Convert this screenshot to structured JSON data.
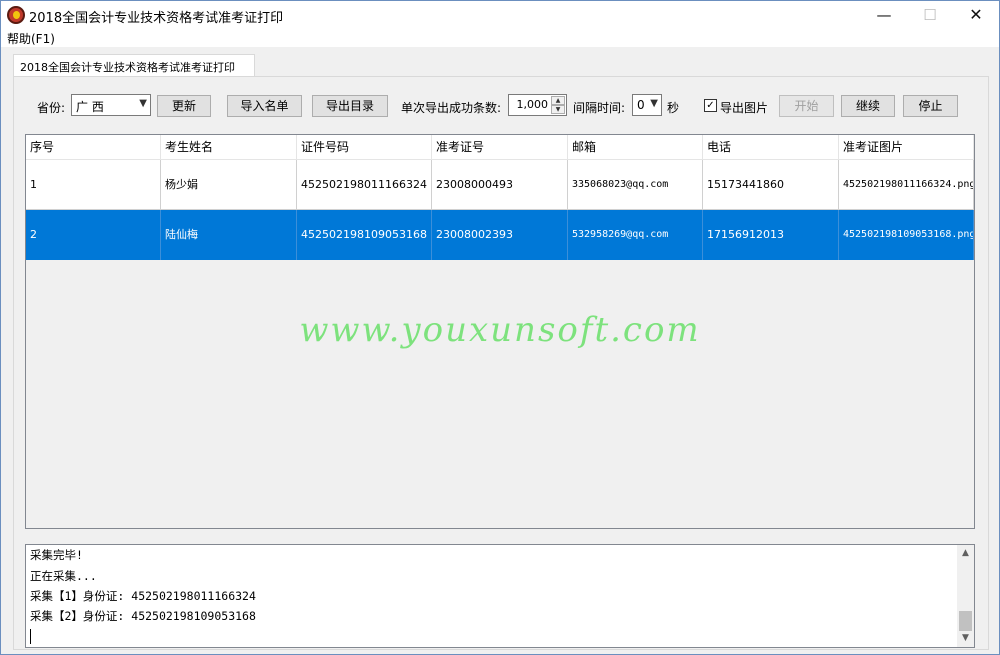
{
  "window": {
    "title": "2018全国会计专业技术资格考试准考证打印",
    "minimize": "—",
    "maximize": "☐",
    "close": "✕"
  },
  "menu": {
    "help": "帮助(F1)"
  },
  "tab": {
    "label": "2018全国会计专业技术资格考试准考证打印"
  },
  "toolbar": {
    "province_label": "省份:",
    "province_value": "广 西",
    "refresh": "更新",
    "import": "导入名单",
    "export_dir": "导出目录",
    "batch_label": "单次导出成功条数:",
    "batch_value": "1,000",
    "interval_label": "间隔时间:",
    "interval_value": "0",
    "seconds_label": "秒",
    "export_image_label": "导出图片",
    "export_image_checked": true,
    "check_mark": "✓",
    "start": "开始",
    "continue": "继续",
    "stop": "停止"
  },
  "table": {
    "headers": [
      "序号",
      "考生姓名",
      "证件号码",
      "准考证号",
      "邮箱",
      "电话",
      "准考证图片"
    ],
    "rows": [
      [
        "1",
        "杨少娟",
        "452502198011166324",
        "23008000493",
        "335068023@qq.com",
        "15173441860",
        "452502198011166324.png"
      ],
      [
        "2",
        "陆仙梅",
        "452502198109053168",
        "23008002393",
        "532958269@qq.com",
        "17156912013",
        "452502198109053168.png"
      ]
    ],
    "selected_row": 1
  },
  "watermark": "www.youxunsoft.com",
  "log": {
    "lines": [
      "采集完毕!",
      "正在采集...",
      "采集【1】身份证: 452502198011166324",
      "采集【2】身份证: 452502198109053168"
    ]
  },
  "colors": {
    "selection": "#0078d7",
    "watermark": "#7de27d",
    "brand_icon": "#c0392b"
  }
}
